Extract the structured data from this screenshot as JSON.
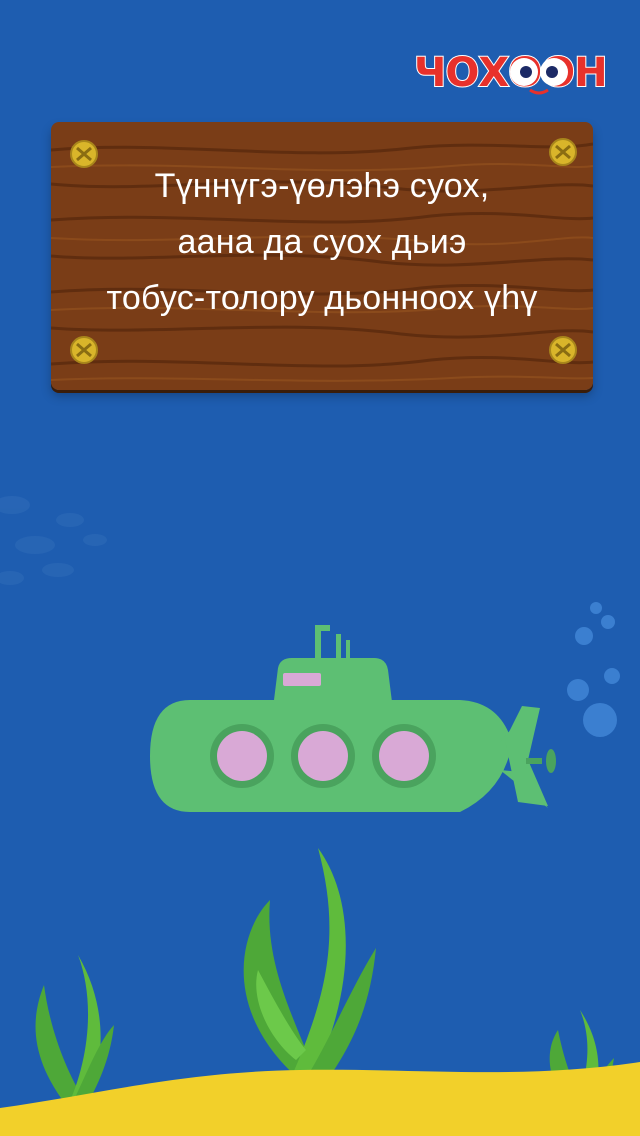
{
  "logo": {
    "text": "ЧОХООН",
    "icon": "eyes-mascot-icon"
  },
  "sign": {
    "lines": [
      "Түннүгэ-үөлэһэ суох,",
      "аана да суох дьиэ",
      "тобус-толору дьонноох үһү"
    ]
  },
  "colors": {
    "water": "#1e5db0",
    "sand": "#f2d02a",
    "submarine": "#5dbf73",
    "portholes": "#d9a9d6",
    "seaweed": "#5fbb3c",
    "wood": "#7a3d17",
    "logo": "#e8312b"
  }
}
